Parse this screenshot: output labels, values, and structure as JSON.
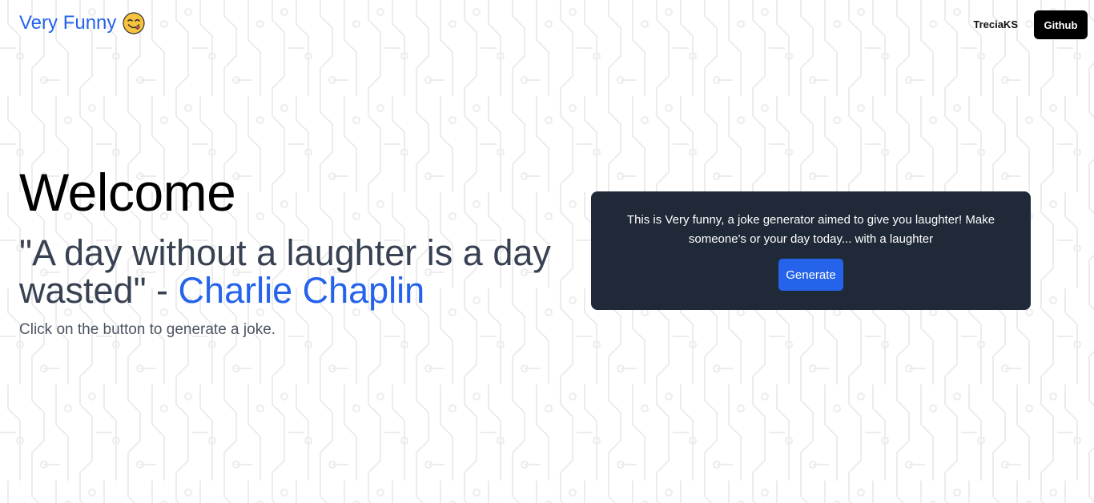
{
  "nav": {
    "brand": "Very Funny",
    "brand_emoji_icon": "face-savoring-food-icon",
    "user": "TreciaKS",
    "github_label": "Github"
  },
  "hero": {
    "title": "Welcome",
    "quote_text": "\"A day without a laughter is a day wasted\" - ",
    "quote_author": "Charlie Chaplin",
    "hint": "Click on the button to generate a joke."
  },
  "card": {
    "description": "This is Very funny, a joke generator aimed to give you laughter! Make someone's or your day today... with a laughter",
    "generate_label": "Generate"
  },
  "colors": {
    "accent": "#2563eb",
    "card_bg": "#1f2937",
    "github_bg": "#000000",
    "pattern": "#eeeeee"
  }
}
